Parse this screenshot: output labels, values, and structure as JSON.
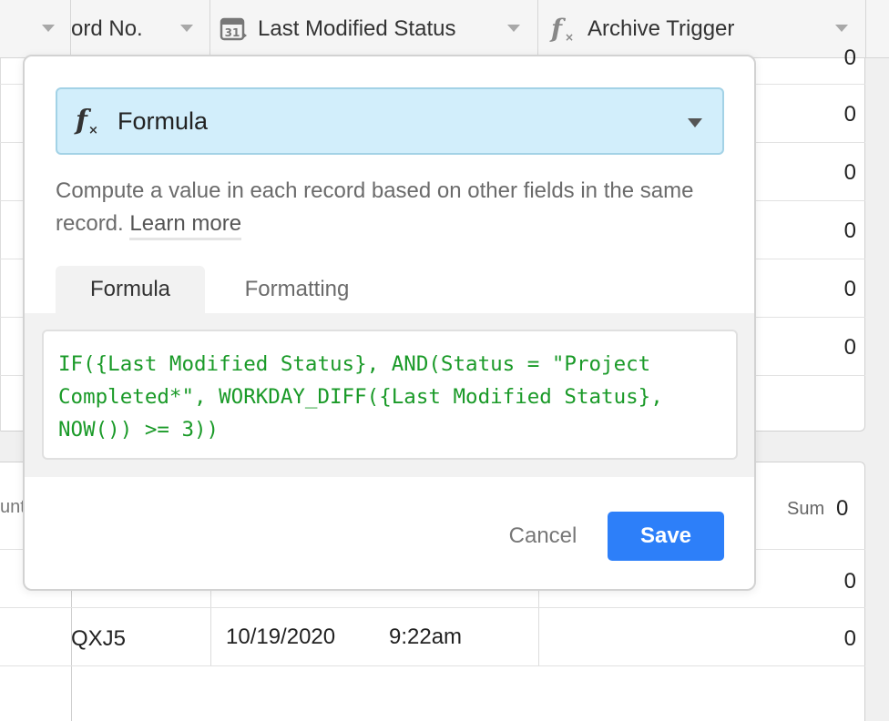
{
  "grid": {
    "columns": [
      {
        "name": "record-no",
        "label": "ord No."
      },
      {
        "name": "last-modified-status",
        "label": "Last Modified Status"
      },
      {
        "name": "archive-trigger",
        "label": "Archive Trigger"
      }
    ],
    "top_values": [
      "0",
      "0",
      "0",
      "0",
      "0"
    ],
    "top_partial_value": "0",
    "summary": {
      "left_label": "unt",
      "sum_label": "Sum",
      "sum_value": "0"
    },
    "bottom_rows": [
      {
        "id": "",
        "date": "",
        "time": "",
        "value": "0"
      },
      {
        "id": "QXJ5",
        "date": "10/19/2020",
        "time": "9:22am",
        "value": "0"
      }
    ]
  },
  "field_editor": {
    "field_type": "Formula",
    "description": "Compute a value in each record based on other fields in the same record.",
    "learn_more": "Learn more",
    "tabs": [
      "Formula",
      "Formatting"
    ],
    "formula": "IF({Last Modified Status}, AND(Status = \"Project Completed*\", WORKDAY_DIFF({Last Modified Status}, NOW()) >= 3))",
    "cancel_label": "Cancel",
    "save_label": "Save"
  },
  "icons": {
    "calendar": "calendar-icon",
    "formula": "formula-icon"
  },
  "colors": {
    "save_button": "#2d7ff9",
    "type_select_bg": "#d2eefb",
    "formula_text": "#1a9a28"
  }
}
